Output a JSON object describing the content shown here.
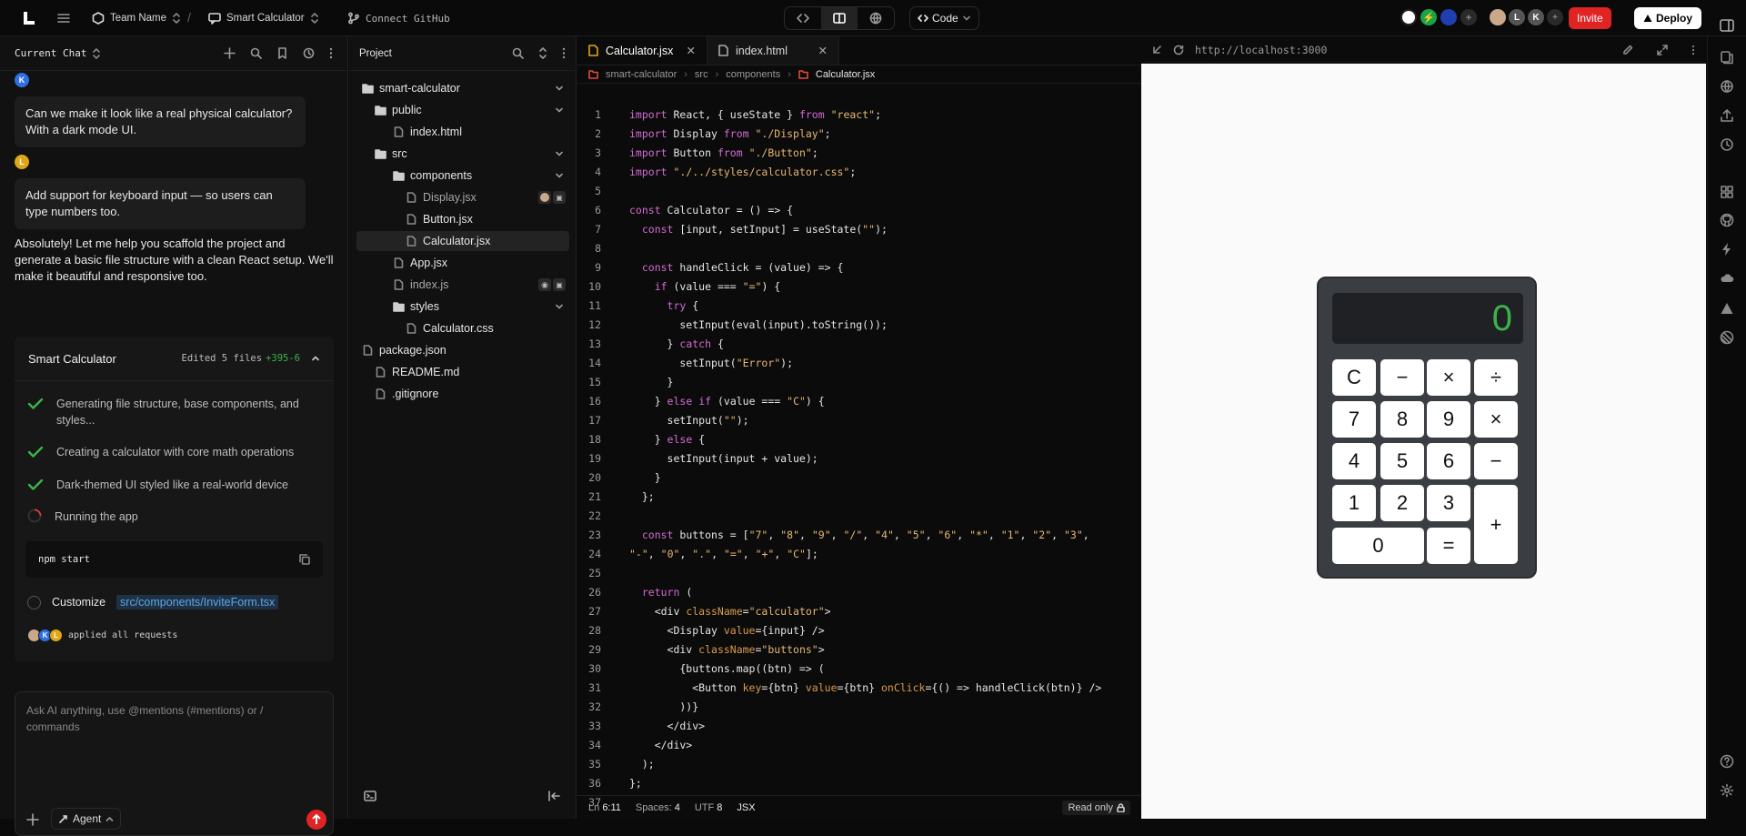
{
  "topbar": {
    "team": "Team Name",
    "project": "Smart Calculator",
    "github": "Connect GitHub",
    "code_label": "Code",
    "avatars": [
      "L",
      "K"
    ],
    "invite": "Invite",
    "deploy": "Deploy"
  },
  "chat": {
    "header": "Current Chat",
    "messages": [
      {
        "author": "K",
        "text": "Can we make it look like a real physical calculator? With a dark mode UI."
      },
      {
        "author": "L",
        "text": "Add support for keyboard input — so users can type numbers too."
      }
    ],
    "reply": "Absolutely! Let me help you scaffold the project and generate a basic file structure with a clean React setup. We'll make it beautiful and responsive too.",
    "card": {
      "title": "Smart Calculator",
      "edited": "Edited 5 files",
      "diff": "+395-6",
      "steps": [
        "Generating file structure, base components, and styles...",
        "Creating a calculator with core math operations",
        "Dark-themed UI styled like a real-world device",
        "Running the app"
      ],
      "command": "npm start",
      "customize": "Customize",
      "customize_path": "src/components/InviteForm.tsx",
      "applied": "applied all requests",
      "applied_avatars": [
        "K",
        "L"
      ]
    },
    "input_placeholder": "Ask AI anything, use @mentions (#mentions) or / commands",
    "agent": "Agent"
  },
  "project": {
    "header": "Project",
    "tree": [
      {
        "name": "smart-calculator",
        "type": "folder",
        "depth": 0,
        "open": true
      },
      {
        "name": "public",
        "type": "folder",
        "depth": 1,
        "open": true
      },
      {
        "name": "index.html",
        "type": "file",
        "depth": 2
      },
      {
        "name": "src",
        "type": "folder",
        "depth": 1,
        "open": true
      },
      {
        "name": "components",
        "type": "folder",
        "depth": 2,
        "open": true
      },
      {
        "name": "Display.jsx",
        "type": "file",
        "depth": 3,
        "dim": true
      },
      {
        "name": "Button.jsx",
        "type": "file",
        "depth": 3
      },
      {
        "name": "Calculator.jsx",
        "type": "file",
        "depth": 3,
        "selected": true
      },
      {
        "name": "App.jsx",
        "type": "file",
        "depth": 2
      },
      {
        "name": "index.js",
        "type": "file",
        "depth": 2,
        "dim": true
      },
      {
        "name": "styles",
        "type": "folder",
        "depth": 2,
        "open": true
      },
      {
        "name": "Calculator.css",
        "type": "file",
        "depth": 3
      },
      {
        "name": "package.json",
        "type": "file",
        "depth": 0
      },
      {
        "name": "README.md",
        "type": "file",
        "depth": 1
      },
      {
        "name": ".gitignore",
        "type": "file",
        "depth": 1
      }
    ]
  },
  "editor": {
    "tabs": [
      "Calculator.jsx",
      "index.html"
    ],
    "breadcrumb": [
      "smart-calculator",
      "src",
      "components",
      "Calculator.jsx"
    ],
    "status": {
      "ln": "Ln",
      "pos": "6:11",
      "spaces_label": "Spaces:",
      "spaces": "4",
      "enc": "UTF",
      "enc_v": "8",
      "lang": "JSX",
      "readonly": "Read only"
    },
    "lines": [
      "import React, { useState } from \"react\";",
      "import Display from \"./Display\";",
      "import Button from \"./Button\";",
      "import \"./../styles/calculator.css\";",
      "",
      "const Calculator = () => {",
      "  const [input, setInput] = useState(\"\");",
      "",
      "  const handleClick = (value) => {",
      "    if (value === \"=\") {",
      "      try {",
      "        setInput(eval(input).toString());",
      "      } catch {",
      "        setInput(\"Error\");",
      "      }",
      "    } else if (value === \"C\") {",
      "      setInput(\"\");",
      "    } else {",
      "      setInput(input + value);",
      "    }",
      "  };",
      "",
      "  const buttons = [\"7\", \"8\", \"9\", \"/\", \"4\", \"5\", \"6\", \"*\", \"1\", \"2\", \"3\",",
      "\"-\", \"0\", \".\", \"=\", \"+\", \"C\"];",
      "",
      "  return (",
      "    <div className=\"calculator\">",
      "      <Display value={input} />",
      "      <div className=\"buttons\">",
      "        {buttons.map((btn) => (",
      "          <Button key={btn} value={btn} onClick={() => handleClick(btn)} />",
      "        ))}",
      "      </div>",
      "    </div>",
      "  );",
      "};",
      ""
    ]
  },
  "preview": {
    "url": "http://localhost:3000",
    "display": "0",
    "keys": [
      "C",
      "−",
      "×",
      "÷",
      "7",
      "8",
      "9",
      "×",
      "4",
      "5",
      "6",
      "−",
      "1",
      "2",
      "3",
      "+",
      "0",
      "="
    ]
  },
  "colors": {
    "accent_red": "#e02424",
    "success": "#3cb34a",
    "display_green": "#3cb34a"
  }
}
